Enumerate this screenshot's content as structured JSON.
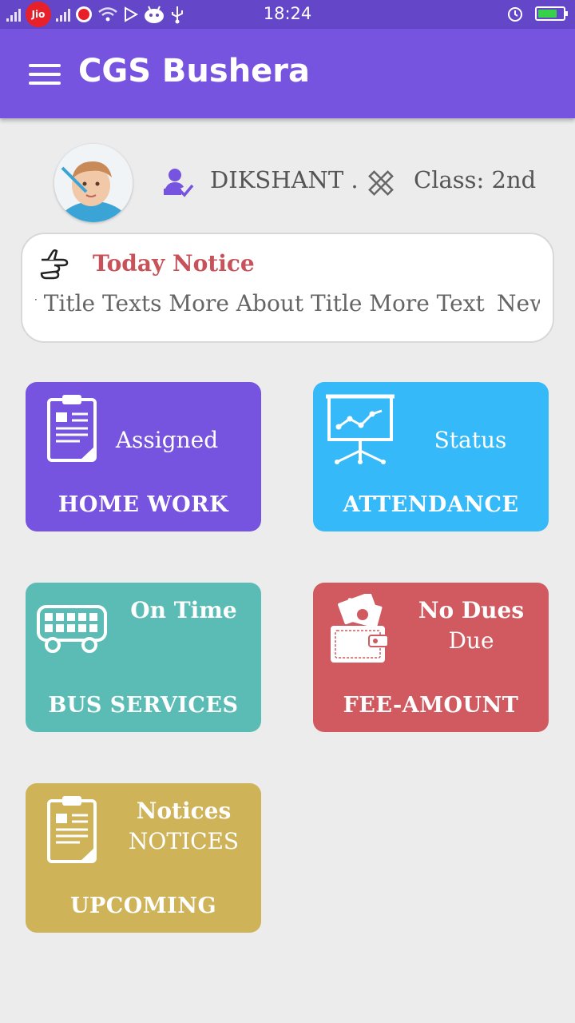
{
  "status_bar": {
    "carrier_badge": "Jio",
    "time": "18:24",
    "icons": [
      "signal-icon",
      "jio-icon",
      "vodafone-icon",
      "wifi-icon",
      "play-store-icon",
      "android-icon",
      "usb-icon",
      "alarm-icon",
      "battery-charging-icon"
    ]
  },
  "app_bar": {
    "title": "CGS Bushera",
    "menu_icon": "hamburger-menu-icon"
  },
  "profile": {
    "name": "DIKSHANT .",
    "class_label": "Class: 2nd",
    "user_icon": "user-check-icon",
    "class_icon": "ruler-pencil-icon"
  },
  "notice": {
    "title": "Today Notice",
    "marquee_text": "y Title Texts More About Title More Text",
    "marquee_next": "New",
    "icon": "pointing-hand-icon"
  },
  "tiles": [
    {
      "status": "Assigned",
      "label": "HOME WORK",
      "icon": "clipboard-icon",
      "color": "#7754e0"
    },
    {
      "status": "Status",
      "label": "ATTENDANCE",
      "icon": "presentation-chart-icon",
      "color": "#36b9f8"
    },
    {
      "status": "On Time",
      "label": "BUS SERVICES",
      "icon": "bus-icon",
      "color": "#5bbcb5"
    },
    {
      "status": "No Dues",
      "status2": "Due",
      "label": "FEE-AMOUNT",
      "icon": "wallet-icon",
      "color": "#d05a60"
    },
    {
      "status": "Notices",
      "status2": "NOTICES",
      "label": "UPCOMING",
      "icon": "clipboard-icon",
      "color": "#cfb358"
    }
  ]
}
